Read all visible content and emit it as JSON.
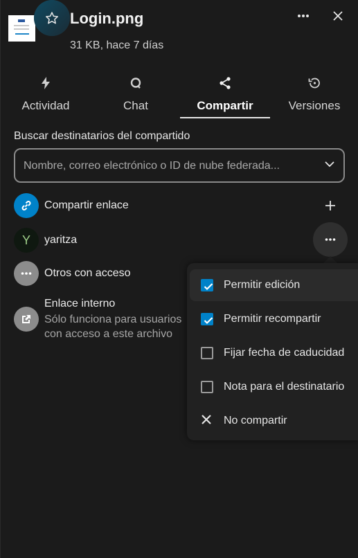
{
  "header": {
    "file_name": "Login.png",
    "file_meta": "31 KB, hace 7 días"
  },
  "tabs": [
    {
      "label": "Actividad",
      "icon": "bolt-icon"
    },
    {
      "label": "Chat",
      "icon": "chat-icon"
    },
    {
      "label": "Compartir",
      "icon": "share-icon",
      "active": true
    },
    {
      "label": "Versiones",
      "icon": "history-icon"
    }
  ],
  "share": {
    "search_label": "Buscar destinatarios del compartido",
    "search_placeholder": "Nombre, correo electrónico o ID de nube federada...",
    "link_label": "Compartir enlace",
    "user": {
      "initial": "Y",
      "name": "yaritza"
    },
    "others_label": "Otros con acceso",
    "internal": {
      "title": "Enlace interno",
      "subtitle": "Sólo funciona para usuarios con acceso a este archivo"
    }
  },
  "menu": {
    "items": [
      {
        "label": "Permitir edición",
        "checked": true
      },
      {
        "label": "Permitir recompartir",
        "checked": true
      },
      {
        "label": "Fijar fecha de caducidad",
        "checked": false
      },
      {
        "label": "Nota para el destinatario",
        "checked": false
      },
      {
        "label": "No compartir",
        "icon": "close-icon"
      }
    ]
  },
  "colors": {
    "accent": "#0082c9",
    "background": "#1b1b1b",
    "menu_background": "#212121"
  }
}
